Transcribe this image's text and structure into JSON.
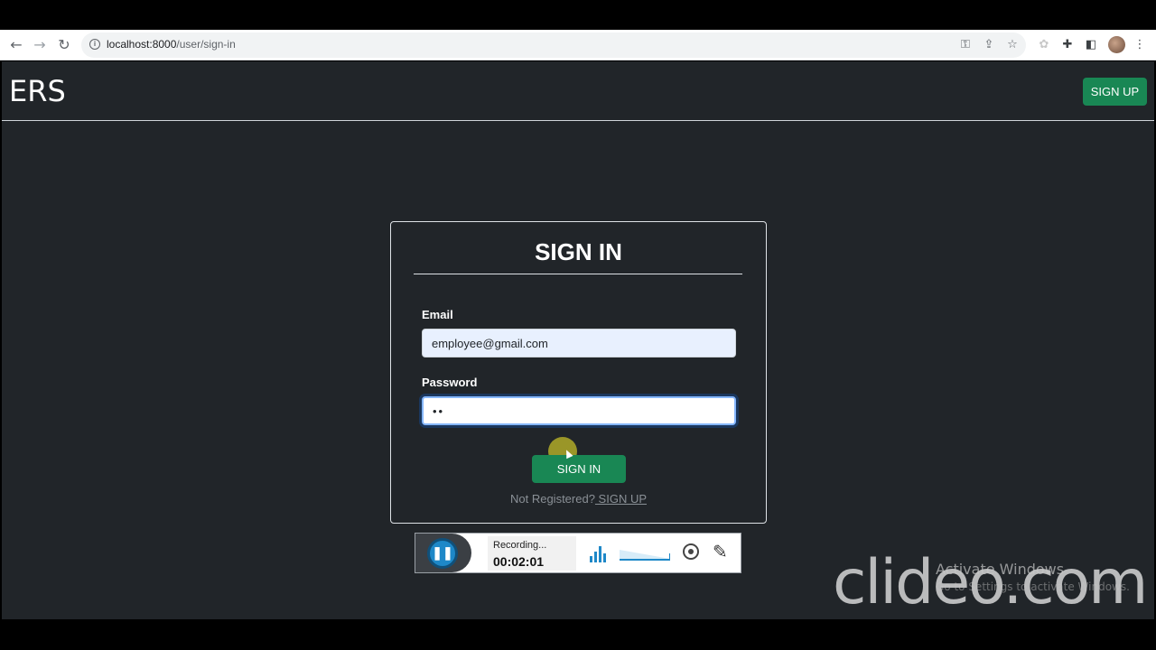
{
  "browser": {
    "url_host": "localhost:8000",
    "url_path": "/user/sign-in",
    "icons": {
      "back": "arrow-left-icon",
      "forward": "arrow-right-icon",
      "reload": "reload-icon",
      "info": "info-icon",
      "key": "key-icon",
      "share": "share-icon",
      "bookmark": "star-icon",
      "extensions": "puzzle-icon",
      "sidepanel": "side-panel-icon",
      "menu": "kebab-menu-icon"
    }
  },
  "navbar": {
    "brand": "ERS",
    "signup_label": "SIGN UP"
  },
  "form": {
    "title": "SIGN IN",
    "email_label": "Email",
    "email_value": "employee@gmail.com",
    "password_label": "Password",
    "password_value": "••",
    "submit_label": "SIGN IN",
    "footer_text": "Not Registered?",
    "footer_link": " SIGN UP"
  },
  "recorder": {
    "status": "Recording...",
    "time": "00:02:01"
  },
  "watermark": {
    "activate_title": "Activate Windows",
    "activate_sub": "Go to Settings to activate Windows.",
    "brand": "clideo.com"
  },
  "colors": {
    "page_bg": "#212529",
    "success": "#198754",
    "recorder_accent": "#1e88c8"
  }
}
